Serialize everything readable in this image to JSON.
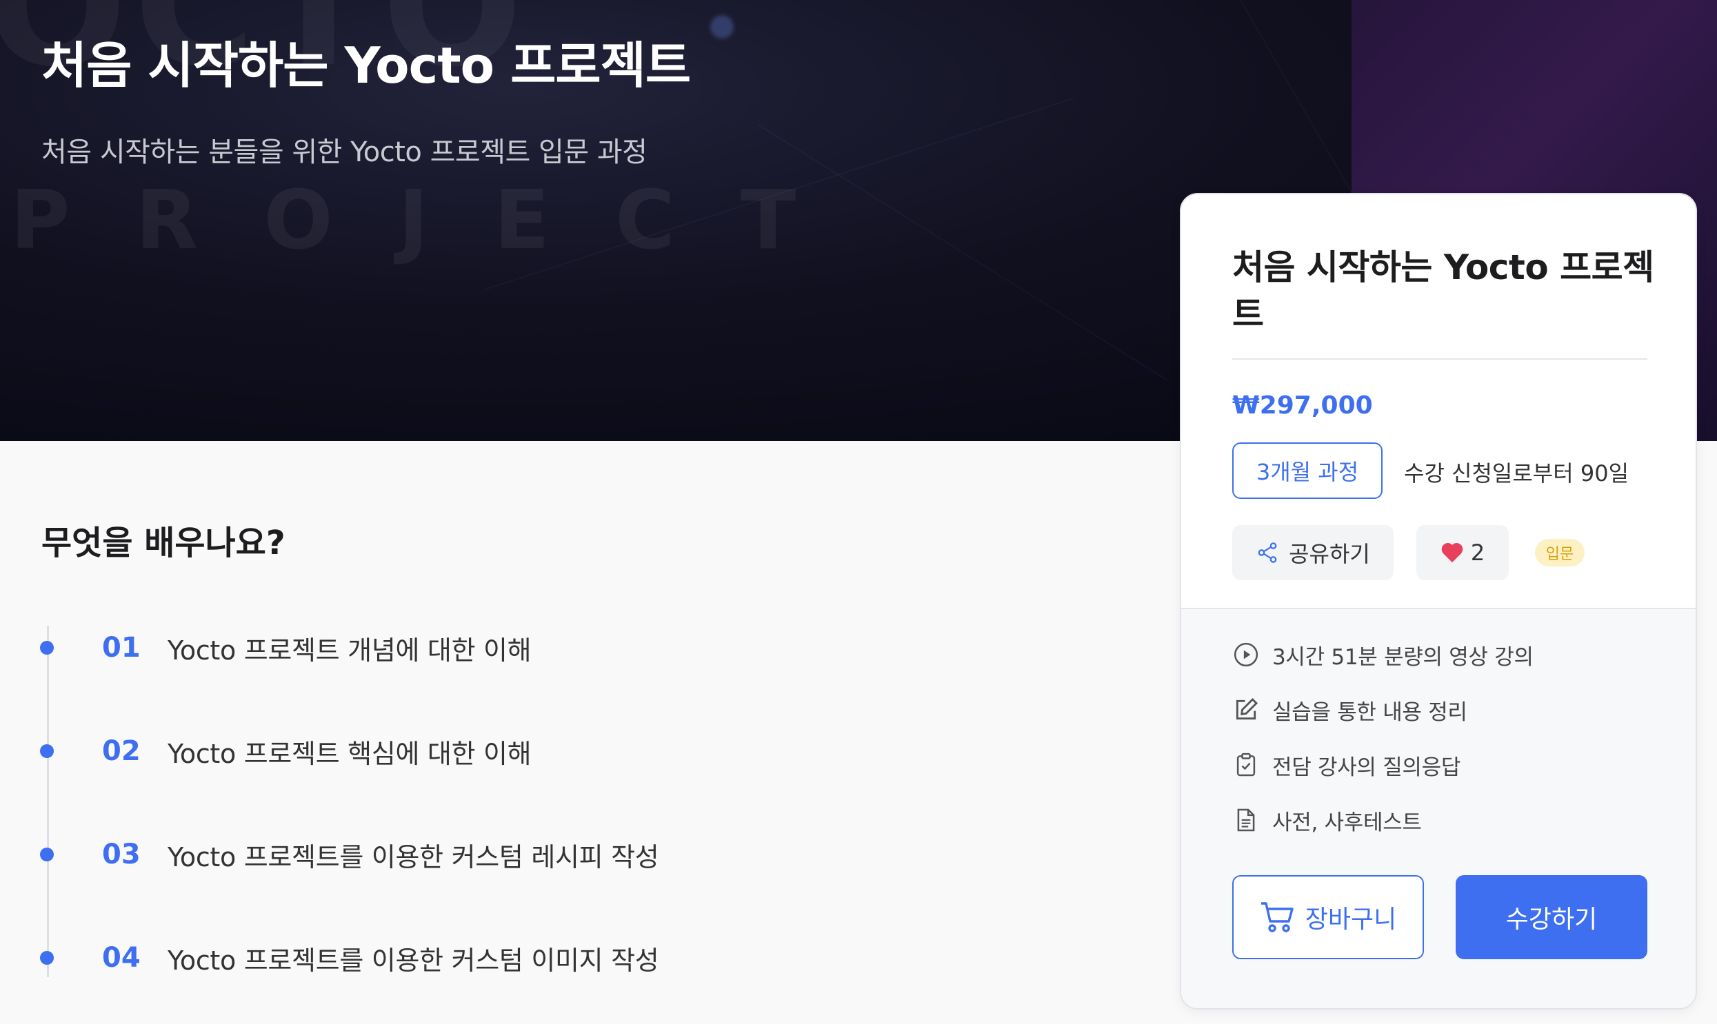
{
  "hero": {
    "title": "처음 시작하는 Yocto 프로젝트",
    "subtitle": "처음 시작하는 분들을 위한 Yocto 프로젝트 입문 과정",
    "watermark": "PROJECT",
    "watermark_top": "OCTO"
  },
  "learn": {
    "title": "무엇을 배우나요?",
    "items": [
      {
        "num": "01",
        "text": "Yocto 프로젝트 개념에 대한 이해"
      },
      {
        "num": "02",
        "text": "Yocto 프로젝트 핵심에 대한 이해"
      },
      {
        "num": "03",
        "text": "Yocto 프로젝트를 이용한 커스텀 레시피 작성"
      },
      {
        "num": "04",
        "text": "Yocto 프로젝트를 이용한 커스텀 이미지 작성"
      }
    ]
  },
  "card": {
    "title": "처음 시작하는 Yocto 프로젝트",
    "price": "₩297,000",
    "period_badge": "3개월 과정",
    "period_desc": "수강 신청일로부터 90일",
    "share_label": "공유하기",
    "like_count": "2",
    "level_badge": "입문",
    "features": [
      {
        "icon": "play-circle-icon",
        "text": "3시간 51분 분량의 영상 강의"
      },
      {
        "icon": "edit-icon",
        "text": "실습을 통한 내용 정리"
      },
      {
        "icon": "clipboard-icon",
        "text": "전담 강사의 질의응답"
      },
      {
        "icon": "document-icon",
        "text": "사전, 사후테스트"
      }
    ],
    "cart_label": "장바구니",
    "enroll_label": "수강하기"
  },
  "colors": {
    "accent": "#3d6ff0",
    "heart": "#e8405c",
    "badge_bg": "#fdf1c4",
    "badge_text": "#d7a20a"
  }
}
